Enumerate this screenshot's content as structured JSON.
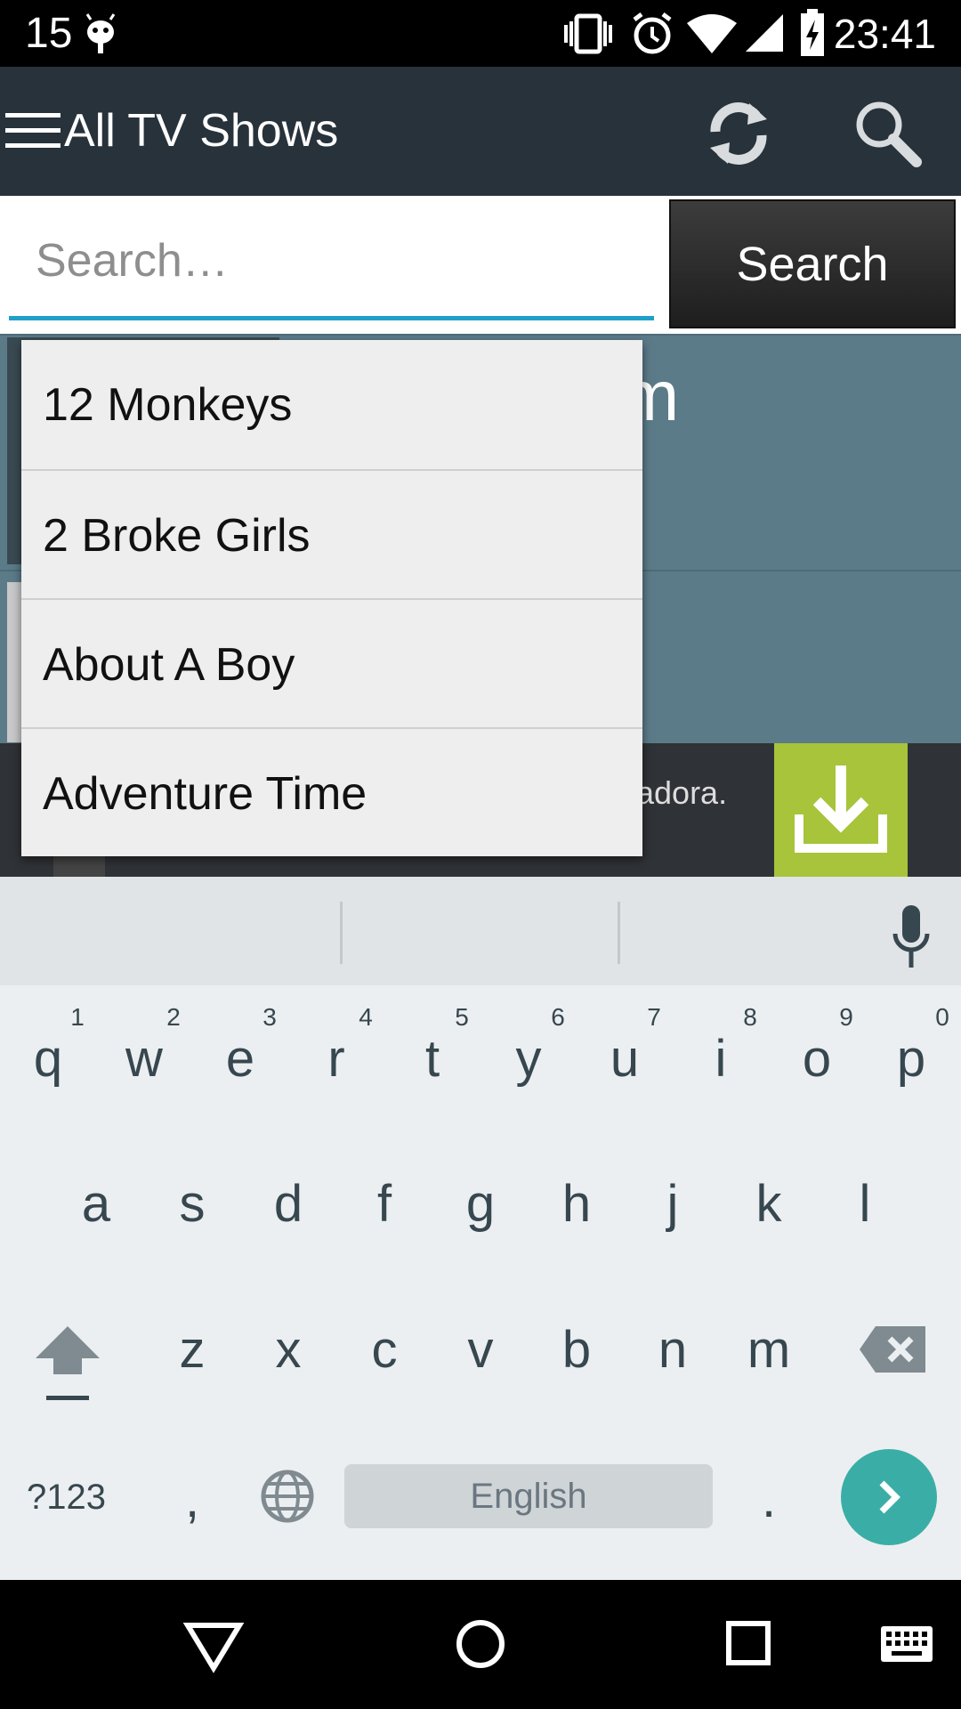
{
  "status_bar": {
    "left_number": "15",
    "time": "23:41"
  },
  "app_bar": {
    "title": "All TV Shows"
  },
  "search": {
    "placeholder": "Search…",
    "button_label": "Search"
  },
  "background_list": {
    "first_title_fragment": "mm"
  },
  "ad": {
    "text_fragment": "adora."
  },
  "dropdown": {
    "items": [
      "12 Monkeys",
      "2 Broke Girls",
      "About A Boy",
      "Adventure Time"
    ]
  },
  "keyboard": {
    "row1": [
      "q",
      "w",
      "e",
      "r",
      "t",
      "y",
      "u",
      "i",
      "o",
      "p"
    ],
    "row1_hints": [
      "1",
      "2",
      "3",
      "4",
      "5",
      "6",
      "7",
      "8",
      "9",
      "0"
    ],
    "row2": [
      "a",
      "s",
      "d",
      "f",
      "g",
      "h",
      "j",
      "k",
      "l"
    ],
    "row3": [
      "z",
      "x",
      "c",
      "v",
      "b",
      "n",
      "m"
    ],
    "symbols_label": "?123",
    "comma": ",",
    "period": ".",
    "space_label": "English"
  },
  "colors": {
    "app_bar": "#27323b",
    "accent": "#20a0c8",
    "enter_key": "#3aaea6",
    "ad_download": "#a7c43a"
  }
}
